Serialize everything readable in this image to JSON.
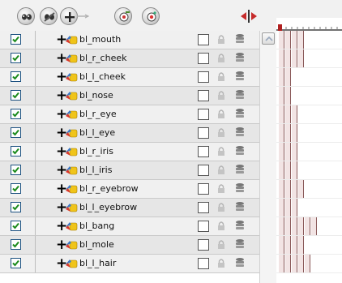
{
  "toolbar": {
    "buttons": [
      {
        "name": "show-all-icon"
      },
      {
        "name": "hide-all-icon"
      },
      {
        "name": "add-layers-icon"
      },
      {
        "name": "add-drawing-layer-icon"
      },
      {
        "name": "add-color-layer-icon"
      }
    ],
    "split_icon": "timeline-split-icon"
  },
  "colors": {
    "check": "#1a8a1a",
    "frame_fill": "#f2e4e4",
    "frame_line": "#8a5a5a",
    "layer_icon_red": "#d9372b",
    "layer_icon_blue": "#3b78c7",
    "layer_icon_yellow": "#f0c419"
  },
  "layers": [
    {
      "name": "bl_mouth",
      "visible": true,
      "frames": 4
    },
    {
      "name": "bl_r_cheek",
      "visible": true,
      "frames": 4
    },
    {
      "name": "bl_l_cheek",
      "visible": true,
      "frames": 2
    },
    {
      "name": "bl_nose",
      "visible": true,
      "frames": 2
    },
    {
      "name": "bl_r_eye",
      "visible": true,
      "frames": 3
    },
    {
      "name": "bl_l_eye",
      "visible": true,
      "frames": 3
    },
    {
      "name": "bl_r_iris",
      "visible": true,
      "frames": 3
    },
    {
      "name": "bl_l_iris",
      "visible": true,
      "frames": 3
    },
    {
      "name": "bl_r_eyebrow",
      "visible": true,
      "frames": 4
    },
    {
      "name": "bl_l_eyebrow",
      "visible": true,
      "frames": 3
    },
    {
      "name": "bl_bang",
      "visible": true,
      "frames": 6
    },
    {
      "name": "bl_mole",
      "visible": true,
      "frames": 4
    },
    {
      "name": "bl_l_hair",
      "visible": true,
      "frames": 5
    }
  ]
}
